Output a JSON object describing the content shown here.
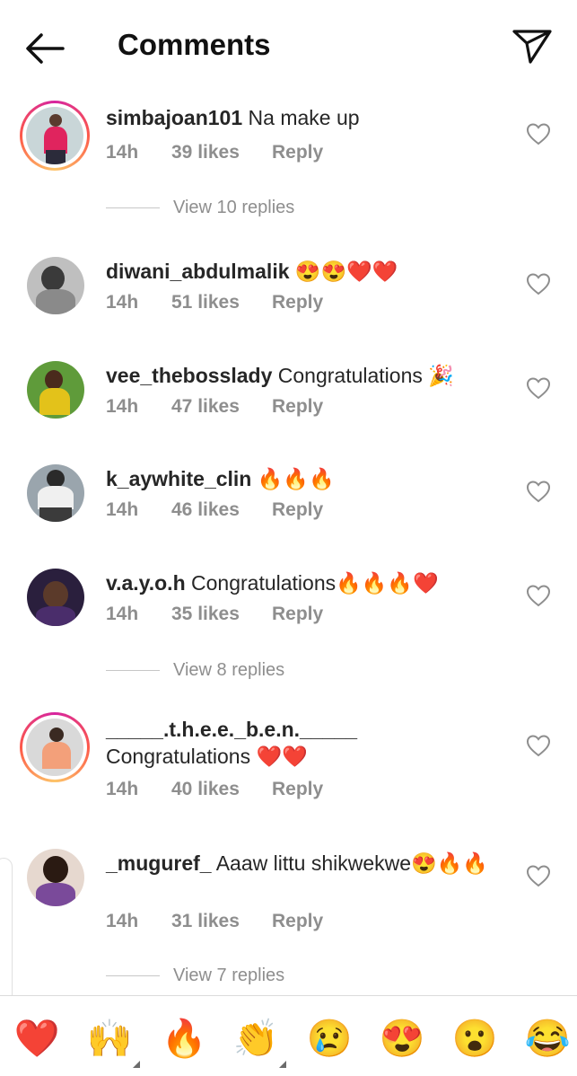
{
  "header": {
    "title": "Comments"
  },
  "comments": [
    {
      "username": "simbajoan101",
      "text": " Na make up",
      "time": "14h",
      "likes": "39 likes",
      "reply": "Reply"
    },
    {
      "username": "diwani_abdulmalik",
      "text": " 😍😍❤️❤️",
      "time": "14h",
      "likes": "51 likes",
      "reply": "Reply"
    },
    {
      "username": "vee_thebosslady",
      "text": " Congratulations 🎉",
      "time": "14h",
      "likes": "47 likes",
      "reply": "Reply"
    },
    {
      "username": "k_aywhite_clin",
      "text": " 🔥🔥🔥",
      "time": "14h",
      "likes": "46 likes",
      "reply": "Reply"
    },
    {
      "username": "v.a.y.o.h",
      "text": " Congratulations🔥🔥🔥❤️",
      "time": "14h",
      "likes": "35 likes",
      "reply": "Reply"
    },
    {
      "username": "_____.t.h.e.e._b.e.n._____",
      "text": "Congratulations ❤️❤️",
      "time": "14h",
      "likes": "40 likes",
      "reply": "Reply"
    },
    {
      "username": "_muguref_",
      "text": " Aaaw littu shikwekwe😍🔥🔥",
      "time": "14h",
      "likes": "31 likes",
      "reply": "Reply"
    }
  ],
  "view_replies": [
    {
      "label": "View 10 replies"
    },
    {
      "label": "View 8 replies"
    },
    {
      "label": "View 7 replies"
    }
  ],
  "emoji_bar": [
    "❤️",
    "🙌",
    "🔥",
    "👏",
    "😢",
    "😍",
    "😮",
    "😂"
  ],
  "icons": {
    "back": "arrow-left-icon",
    "send": "paper-plane-icon",
    "like": "heart-outline-icon"
  },
  "colors": {
    "text": "#262626",
    "secondary": "#8e8e8e",
    "story_ring_start": "#d6249f",
    "story_ring_end": "#fdc468"
  }
}
